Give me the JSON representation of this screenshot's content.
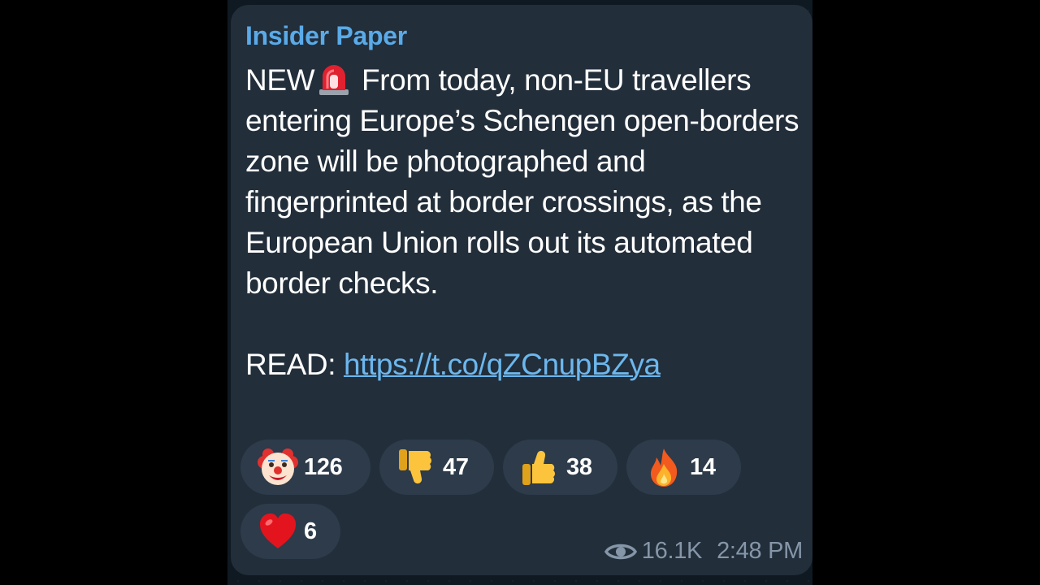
{
  "post": {
    "channel": "Insider Paper",
    "headline_prefix": "NEW",
    "headline_icon": "rotating-light-siren-emoji",
    "body": "From today, non-EU travellers entering Europe’s Schengen open-borders zone will be photographed and fingerprinted at border crossings, as the European Union rolls out its automated border checks.",
    "read_label": "READ:",
    "link_text": "https://t.co/qZCnupBZya"
  },
  "reactions": [
    {
      "emoji": "clown-face-emoji",
      "count": "126"
    },
    {
      "emoji": "thumbs-down-emoji",
      "count": "47"
    },
    {
      "emoji": "thumbs-up-emoji",
      "count": "38"
    },
    {
      "emoji": "fire-emoji",
      "count": "14"
    },
    {
      "emoji": "red-heart-emoji",
      "count": "6"
    }
  ],
  "meta": {
    "views_icon": "eye-icon",
    "views": "16.1K",
    "time": "2:48 PM"
  },
  "colors": {
    "bubble": "#222e3a",
    "channel_name": "#5aaae8",
    "link": "#6cb7ee",
    "reaction_chip": "#2d3b4a",
    "meta_text": "#8596a8"
  }
}
